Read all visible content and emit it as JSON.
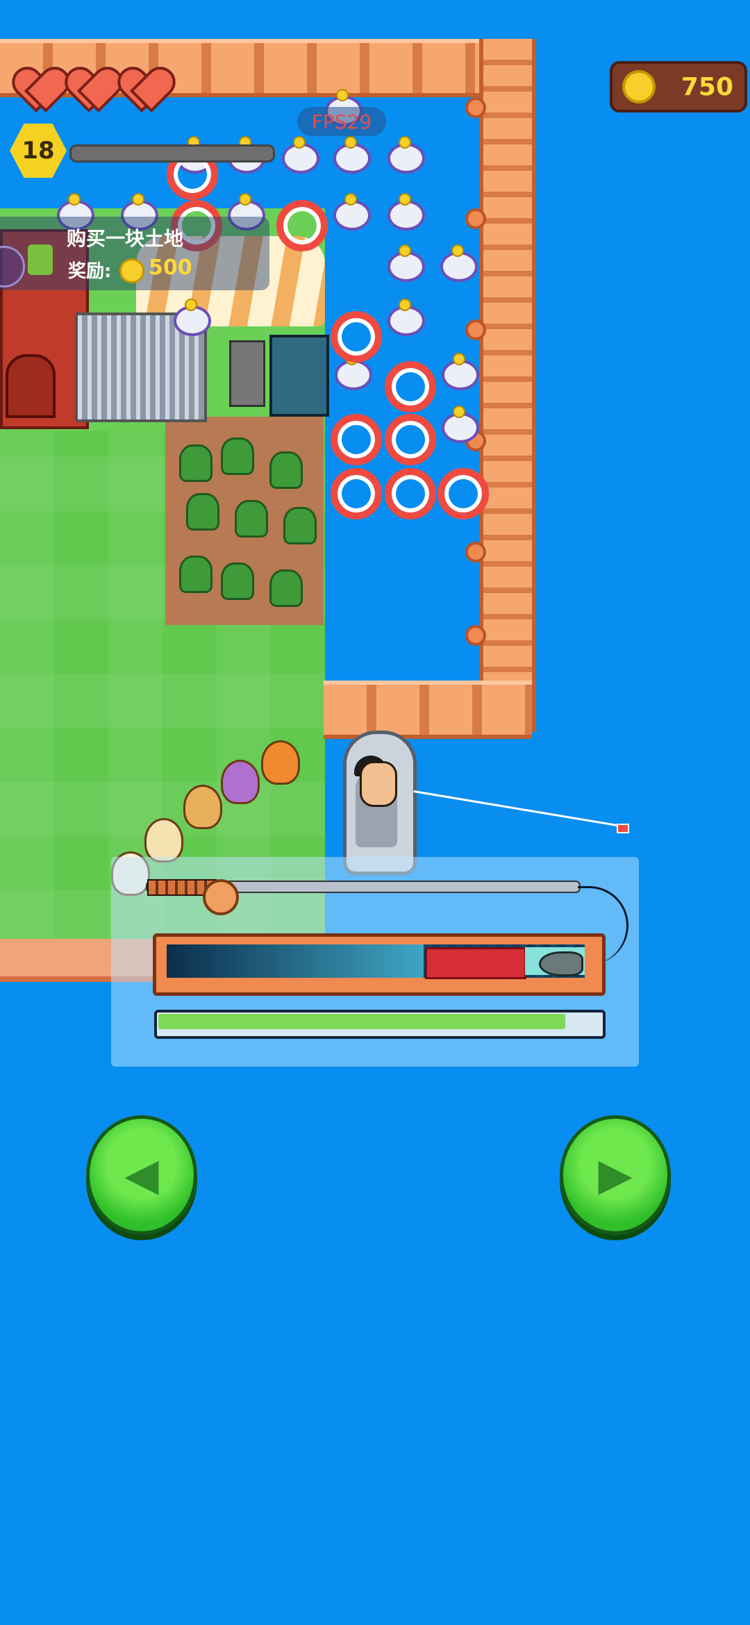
{
  "hud": {
    "hearts": 3,
    "level": "18",
    "fps_label": "FPS29",
    "coins": "750"
  },
  "quest": {
    "title": "购买一块土地",
    "reward_label": "奖励:",
    "reward_value": "500"
  },
  "fishing": {
    "catch_progress": 0.93,
    "tension_zone_start": 0.64,
    "tension_zone_end": 0.86
  },
  "controls": {
    "left_icon": "left-arrow-icon",
    "right_icon": "right-arrow-icon"
  },
  "colors": {
    "water": "#078ef0",
    "grass": "#62c94f",
    "button_green": "#2fbf2a",
    "coin_gold": "#ffd93a",
    "tension_red": "#d62d38"
  }
}
